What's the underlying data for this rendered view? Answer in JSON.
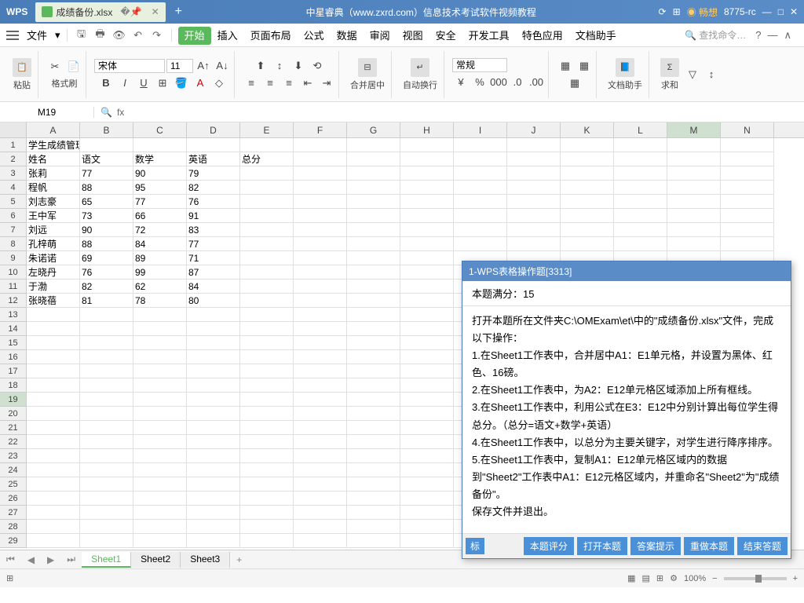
{
  "titlebar": {
    "logo": "WPS",
    "tab_name": "成绩备份.xlsx",
    "title": "中星睿典（www.zxrd.com）信息技术考试软件视频教程",
    "user": "畅想",
    "version": "8775-rc"
  },
  "menubar": {
    "file": "文件",
    "tabs": [
      "开始",
      "插入",
      "页面布局",
      "公式",
      "数据",
      "审阅",
      "视图",
      "安全",
      "开发工具",
      "特色应用",
      "文档助手"
    ],
    "search": "查找命令…"
  },
  "ribbon": {
    "paste": "粘贴",
    "format_painter": "格式刷",
    "font_name": "宋体",
    "font_size": "11",
    "merge": "合并居中",
    "wrap": "自动换行",
    "number_format": "常规",
    "doc_helper": "文档助手",
    "sum": "求和"
  },
  "namebox": {
    "ref": "M19",
    "fx": "fx"
  },
  "columns": [
    "A",
    "B",
    "C",
    "D",
    "E",
    "F",
    "G",
    "H",
    "I",
    "J",
    "K",
    "L",
    "M",
    "N"
  ],
  "active_col": "M",
  "active_row": 19,
  "sheet_data": {
    "title_row": "学生成绩管理",
    "headers": [
      "姓名",
      "语文",
      "数学",
      "英语",
      "总分"
    ],
    "rows": [
      [
        "张莉",
        "77",
        "90",
        "79",
        ""
      ],
      [
        "程帆",
        "88",
        "95",
        "82",
        ""
      ],
      [
        "刘志豪",
        "65",
        "77",
        "76",
        ""
      ],
      [
        "王中军",
        "73",
        "66",
        "91",
        ""
      ],
      [
        "刘远",
        "90",
        "72",
        "83",
        ""
      ],
      [
        "孔梓萌",
        "88",
        "84",
        "77",
        ""
      ],
      [
        "朱诺诺",
        "69",
        "89",
        "71",
        ""
      ],
      [
        "左晓丹",
        "76",
        "99",
        "87",
        ""
      ],
      [
        "于渤",
        "82",
        "62",
        "84",
        ""
      ],
      [
        "张晓蓓",
        "81",
        "78",
        "80",
        ""
      ]
    ]
  },
  "sheets": [
    "Sheet1",
    "Sheet2",
    "Sheet3"
  ],
  "active_sheet": "Sheet1",
  "statusbar": {
    "zoom": "100%"
  },
  "popup": {
    "title": "1-WPS表格操作题[3313]",
    "score": "本题满分：15",
    "body": "打开本题所在文件夹C:\\OMExam\\et\\中的\"成绩备份.xlsx\"文件，完成以下操作：\n1.在Sheet1工作表中，合并居中A1：E1单元格，并设置为黑体、红色、16磅。\n2.在Sheet1工作表中，为A2：E12单元格区域添加上所有框线。\n3.在Sheet1工作表中，利用公式在E3：E12中分别计算出每位学生得总分。（总分=语文+数学+英语）\n4.在Sheet1工作表中，以总分为主要关键字，对学生进行降序排序。\n5.在Sheet1工作表中，复制A1：E12单元格区域内的数据到\"Sheet2\"工作表中A1：E12元格区域内，并重命名\"Sheet2\"为\"成绩备份\"。\n保存文件并退出。",
    "tag": "标",
    "buttons": [
      "本题评分",
      "打开本题",
      "答案提示",
      "重做本题",
      "结束答题"
    ]
  }
}
